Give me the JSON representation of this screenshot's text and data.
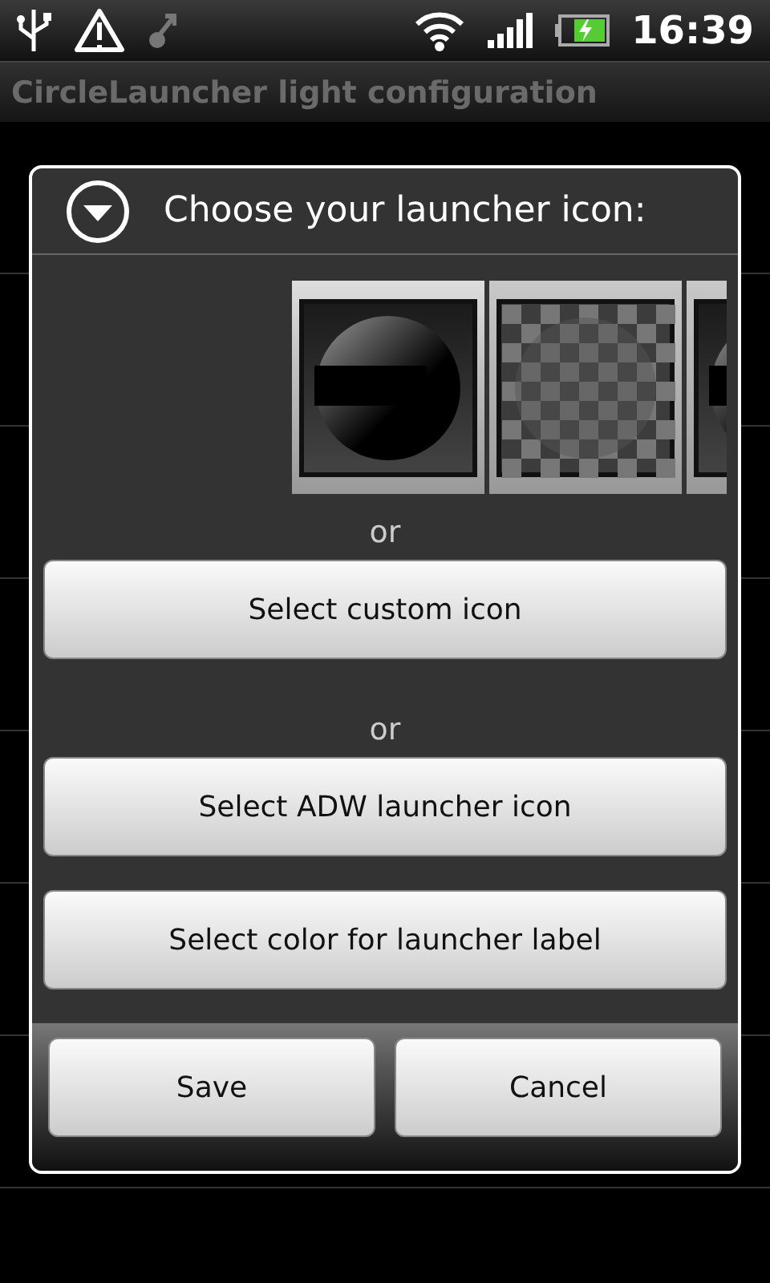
{
  "status_bar": {
    "time": "16:39"
  },
  "title_bar": {
    "title": "CircleLauncher light configuration"
  },
  "dialog": {
    "title": "Choose your launcher icon:",
    "icons": [
      {
        "kind": "dark",
        "selected": true
      },
      {
        "kind": "checker",
        "selected": false
      },
      {
        "kind": "dark",
        "selected": false
      }
    ],
    "items": [
      {
        "kind": "separator",
        "text": "or"
      },
      {
        "kind": "button",
        "text": "Select custom icon"
      },
      {
        "kind": "separator",
        "text": "or"
      },
      {
        "kind": "button",
        "text": "Select ADW launcher icon"
      },
      {
        "kind": "button",
        "text": "Select color for launcher label"
      }
    ],
    "buttons": [
      "Save",
      "Cancel"
    ]
  }
}
